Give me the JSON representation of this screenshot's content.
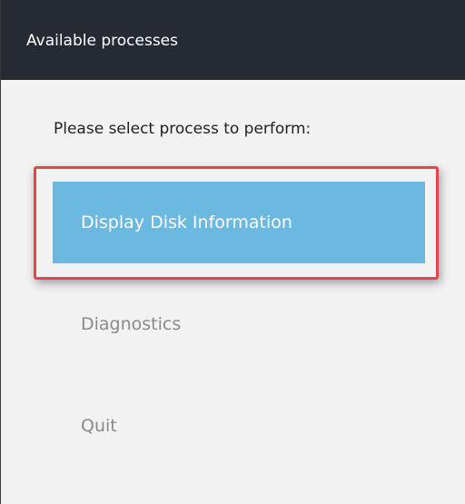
{
  "window": {
    "title": "Available processes"
  },
  "main": {
    "prompt": "Please select process to perform:",
    "options": [
      {
        "label": "Display Disk Information",
        "selected": true
      },
      {
        "label": "Diagnostics",
        "selected": false
      },
      {
        "label": "Quit",
        "selected": false
      }
    ]
  },
  "colors": {
    "titlebar": "#252a33",
    "selected_option": "#6bb8e1",
    "highlight_border": "#e8434b",
    "background": "#f2f2f2"
  }
}
